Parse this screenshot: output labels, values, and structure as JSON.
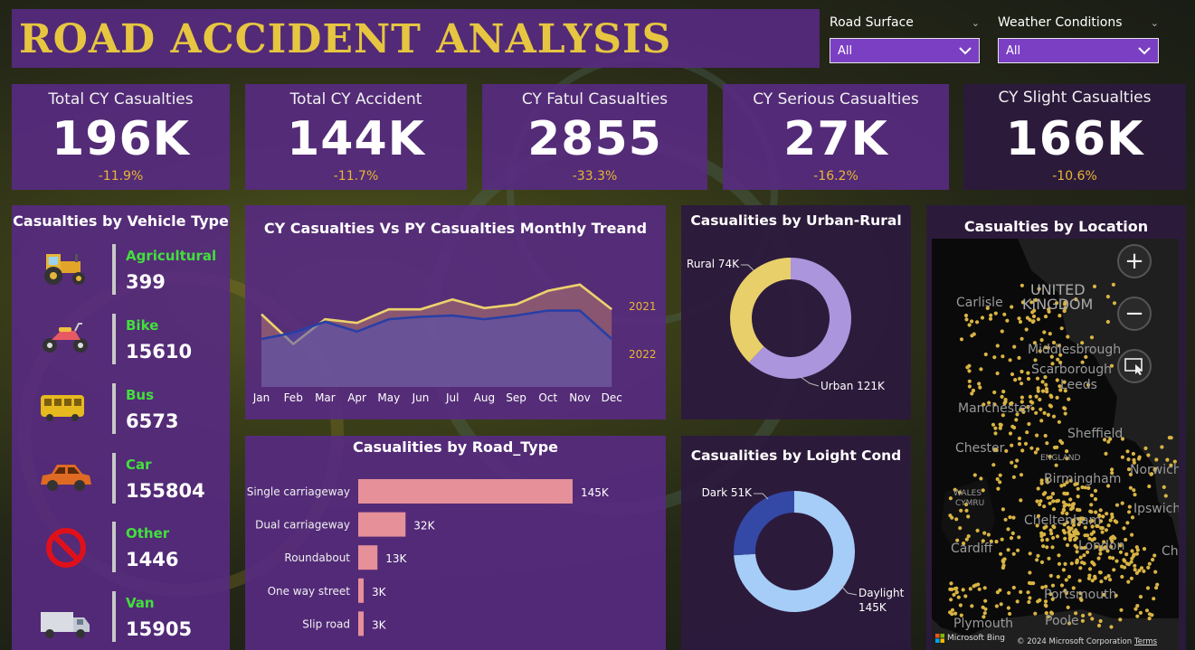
{
  "title": "ROAD ACCIDENT ANALYSIS",
  "filters": [
    {
      "label": "Road Surface",
      "value": "All"
    },
    {
      "label": "Weather Conditions",
      "value": "All"
    }
  ],
  "kpis": [
    {
      "title": "Total CY Casualties",
      "value": "196K",
      "change": "-11.9%"
    },
    {
      "title": "Total CY Accident",
      "value": "144K",
      "change": "-11.7%"
    },
    {
      "title": "CY Fatul Casualties",
      "value": "2855",
      "change": "-33.3%"
    },
    {
      "title": "CY Serious Casualties",
      "value": "27K",
      "change": "-16.2%"
    },
    {
      "title": "CY Slight Casualties",
      "value": "166K",
      "change": "-10.6%"
    }
  ],
  "vehicle_panel": {
    "title": "Casualties by Vehicle Type",
    "items": [
      {
        "label": "Agricultural",
        "value": "399",
        "icon": "tractor-icon"
      },
      {
        "label": "Bike",
        "value": "15610",
        "icon": "motorbike-icon"
      },
      {
        "label": "Bus",
        "value": "6573",
        "icon": "bus-icon"
      },
      {
        "label": "Car",
        "value": "155804",
        "icon": "car-icon"
      },
      {
        "label": "Other",
        "value": "1446",
        "icon": "prohibited-icon"
      },
      {
        "label": "Van",
        "value": "15905",
        "icon": "van-icon"
      }
    ]
  },
  "chart_data": [
    {
      "type": "area",
      "title": "CY Casualties Vs PY Casualties Monthly Treand",
      "categories": [
        "Jan",
        "Feb",
        "Mar",
        "Apr",
        "May",
        "Jun",
        "Jul",
        "Aug",
        "Sep",
        "Oct",
        "Nov",
        "Dec"
      ],
      "series": [
        {
          "name": "2021",
          "values": [
            15800,
            13400,
            15400,
            15100,
            16200,
            16200,
            17000,
            16300,
            16600,
            17700,
            18200,
            16200
          ],
          "color": "#ecd26b"
        },
        {
          "name": "2022",
          "values": [
            13800,
            14300,
            15200,
            14400,
            15400,
            15600,
            15700,
            15400,
            15700,
            16100,
            16100,
            13800
          ],
          "color": "#283fa6"
        }
      ],
      "ylim": [
        10000,
        19500
      ]
    },
    {
      "type": "pie",
      "title": "Casualities by Urban-Rural",
      "labels": [
        "Urban",
        "Rural"
      ],
      "values": [
        121,
        74
      ],
      "display": [
        "121K",
        "74K"
      ],
      "colors": [
        "#ab95dc",
        "#e8cf6a"
      ]
    },
    {
      "type": "bar",
      "title": "Casualities by Road_Type",
      "categories": [
        "Single carriageway",
        "Dual carriageway",
        "Roundabout",
        "One way street",
        "Slip road"
      ],
      "values": [
        145,
        32,
        13,
        3,
        3
      ],
      "display": [
        "145K",
        "32K",
        "13K",
        "3K",
        "3K"
      ],
      "color": "#e6909a"
    },
    {
      "type": "pie",
      "title": "Casualities by Loight Cond",
      "labels": [
        "Daylight",
        "Dark"
      ],
      "values": [
        145,
        51
      ],
      "display": [
        "145K",
        "51K"
      ],
      "colors": [
        "#a5cdf7",
        "#3448a6"
      ]
    }
  ],
  "map": {
    "title": "Casualties by Location",
    "place_labels": [
      "Carlisle",
      "UNITED",
      "KINGDOM",
      "Middlesbrough",
      "Scarborough",
      "Leeds",
      "Manchester",
      "Sheffield",
      "Chester",
      "ENGLAND",
      "Norwich",
      "WALES",
      "CYMRU",
      "Birmingham",
      "Ipswich",
      "Cheltenham",
      "Cardiff",
      "London",
      "Portsmouth",
      "Plymouth",
      "Poole",
      "Chel"
    ],
    "bing_label": "Microsoft Bing",
    "copyright": "© 2024 Microsoft Corporation",
    "terms": "Terms",
    "zoom_in": "+",
    "zoom_out": "−",
    "dot_color": "#d9b443"
  }
}
